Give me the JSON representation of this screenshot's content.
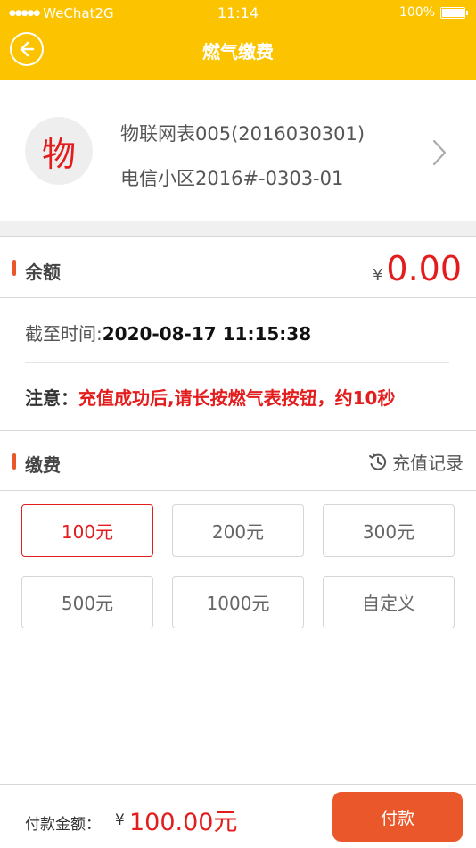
{
  "status_bar": {
    "signal": "●●●●●",
    "carrier": "WeChat2G",
    "time": "11:14",
    "battery_percent": "100%"
  },
  "header": {
    "title": "燃气缴费",
    "back_icon": "back-arrow-circle-icon"
  },
  "meter": {
    "avatar_char": "物",
    "name": "物联网表005(2016030301)",
    "address": "电信小区2016#-0303-01"
  },
  "balance": {
    "label": "余额",
    "currency": "¥",
    "amount": "0.00"
  },
  "info": {
    "as_of_label": "截至时间:",
    "as_of_value": "2020-08-17 11:15:38",
    "notice_label": "注意：",
    "notice_text": "充值成功后,请长按燃气表按钮，约10秒"
  },
  "payment": {
    "label": "缴费",
    "records_label": "充值记录",
    "options": [
      "100元",
      "200元",
      "300元",
      "500元",
      "1000元",
      "自定义"
    ],
    "selected_index": 0
  },
  "footer": {
    "pay_amount_label": "付款金额：",
    "currency": "¥",
    "pay_amount": "100.00元",
    "pay_button": "付款"
  },
  "colors": {
    "header_bg": "#fcc400",
    "accent_red": "#e31d1d",
    "pay_button": "#e9572b"
  }
}
